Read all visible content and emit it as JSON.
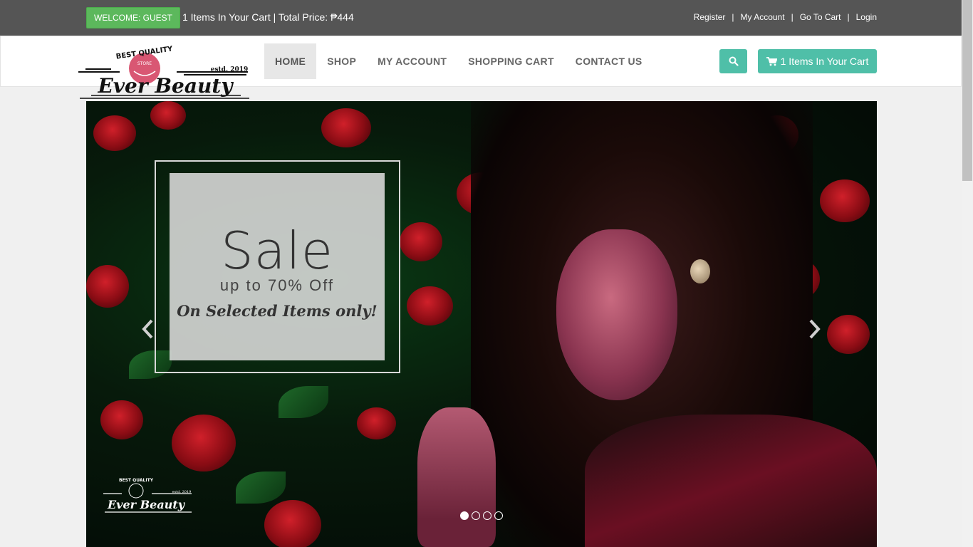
{
  "topbar": {
    "welcome": "WELCOME: GUEST",
    "cart_summary": "1 Items In Your Cart | Total Price: ₱444",
    "links": [
      "Register",
      "My Account",
      "Go To Cart",
      "Login"
    ],
    "separator": "|"
  },
  "brand": {
    "top_text": "BEST QUALITY",
    "name": "Ever Beauty",
    "est": "estd. 2019",
    "badge": "STORE"
  },
  "nav": {
    "items": [
      {
        "label": "HOME",
        "active": true
      },
      {
        "label": "SHOP",
        "active": false
      },
      {
        "label": "MY ACCOUNT",
        "active": false
      },
      {
        "label": "SHOPPING CART",
        "active": false
      },
      {
        "label": "CONTACT US",
        "active": false
      }
    ],
    "cart_button": "1 Items In Your Cart"
  },
  "carousel": {
    "slide": {
      "title": "Sale",
      "subtitle": "up to 70% Off",
      "note": "On Selected Items only!"
    },
    "watermark": {
      "top_text": "BEST QUALITY",
      "name": "Ever Beauty",
      "est": "estd. 2019"
    },
    "slide_count": 4,
    "active_slide": 1
  },
  "colors": {
    "topbar": "#555555",
    "welcome": "#5cb85c",
    "accent": "#4fbfa8",
    "active_nav_bg": "#e7e7e7"
  },
  "icons": {
    "search": "search-icon",
    "cart": "cart-icon",
    "prev": "chevron-left-icon",
    "next": "chevron-right-icon"
  }
}
